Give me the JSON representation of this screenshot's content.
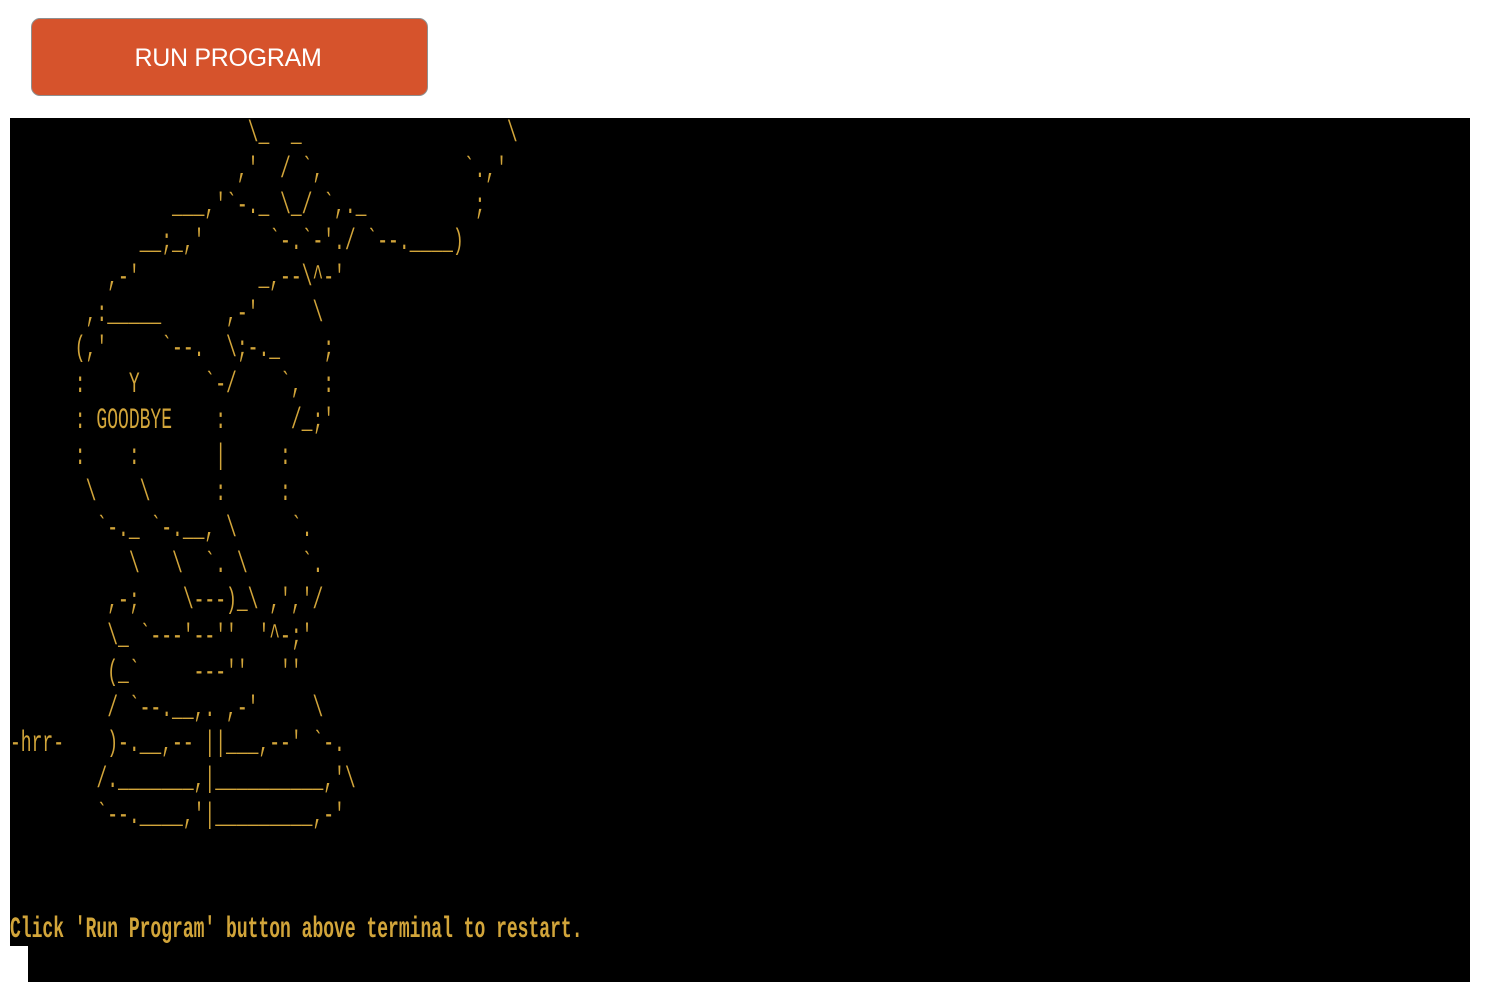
{
  "toolbar": {
    "run_label": "RUN PROGRAM"
  },
  "terminal": {
    "ascii_art": "                      \\_  _                   \\\n                     ,'  / `,             `.,'\n               ___,'`-._ \\_/ `,._          ;\n            __;_,'      `-.`-'./ `--.____)\n         ,-'           _,--\\^-'\n       ,:_____      ,-'     \\\n      (,'     `--.  \\;-._    ;\n      :    Y      `-/    `,  :\n      : GOODBYE    :      /_;'\n      :    :       |     :\n       \\    \\      :     :\n        `-._ `-.__, \\     `.\n           \\   \\  `. \\     `.\n         ,-;    \\---)_\\ ,','/\n         \\_ `---'--''  '^-;'\n         (_`     ---''   ''\n         / `--.__,. ,-'     \\\n-hrr-    )-.__,-- ||___,--' `-.\n        /._______,|__________,'\\\n        `--.____,'|_________,-'",
    "restart_message": "Click 'Run Program' button above terminal to restart."
  },
  "colors": {
    "button_bg": "#d6532c",
    "terminal_bg": "#000000",
    "terminal_fg": "#d2a53a"
  }
}
